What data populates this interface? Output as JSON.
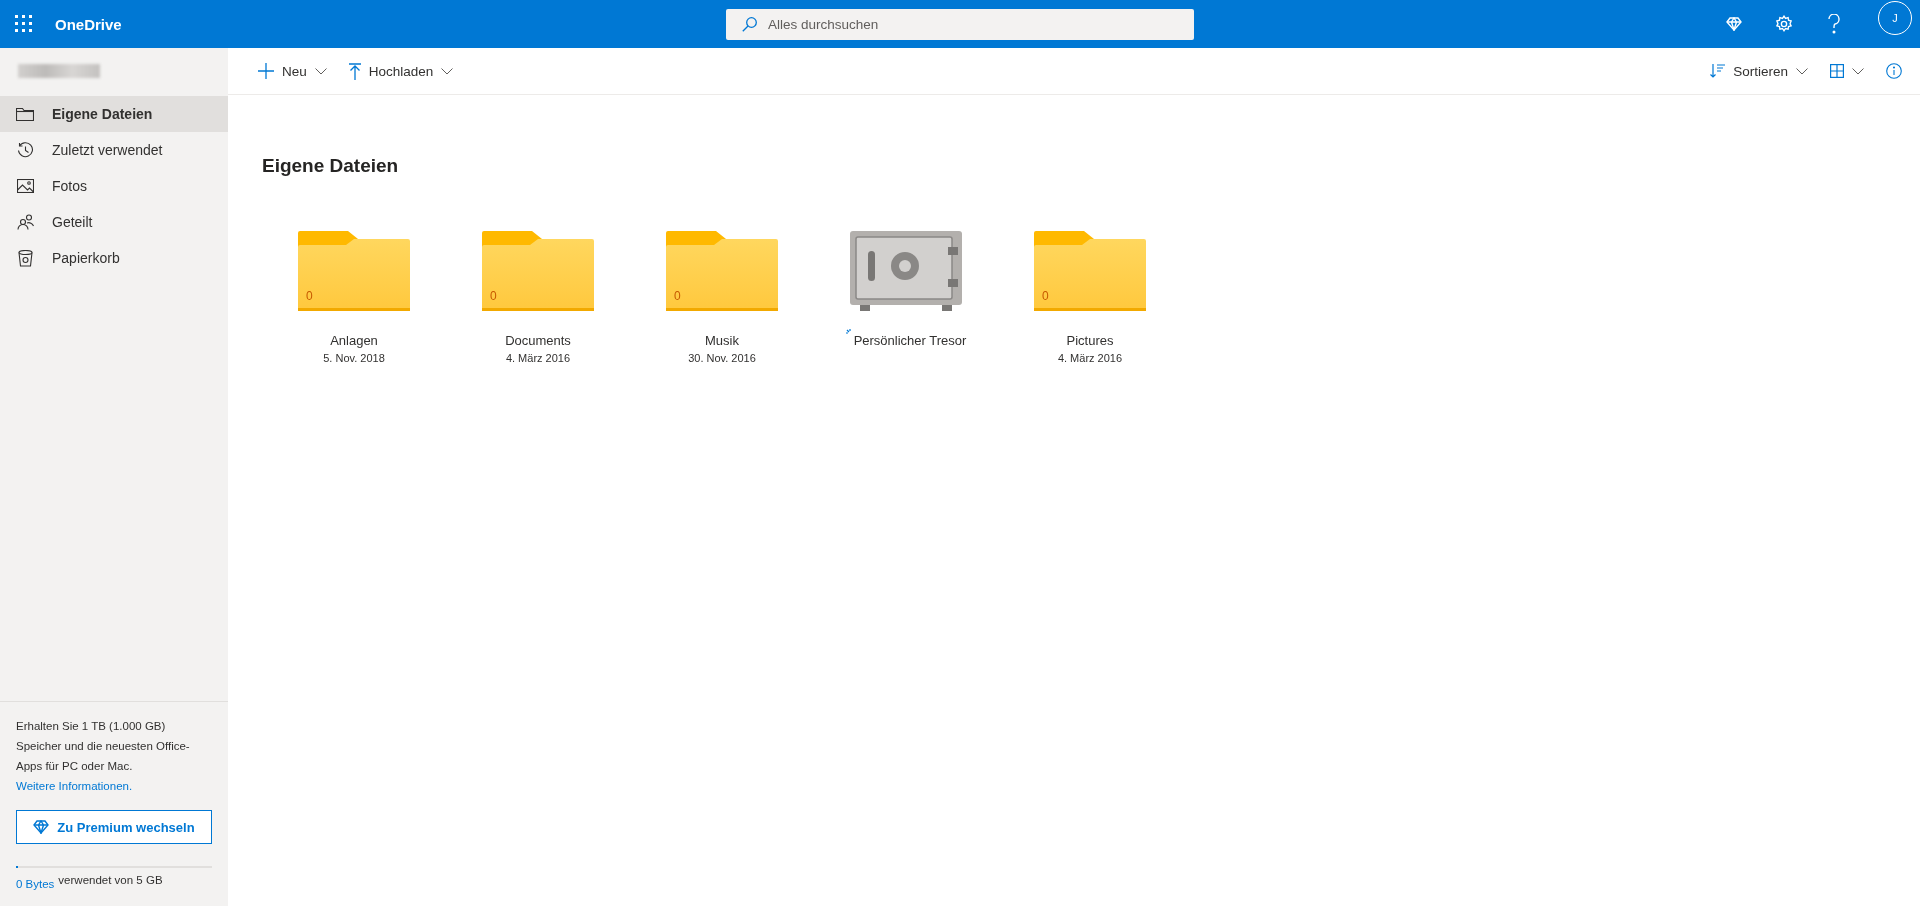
{
  "header": {
    "app_name": "OneDrive",
    "search": {
      "placeholder": "Alles durchsuchen"
    },
    "avatar": "J"
  },
  "sidebar": {
    "items": [
      {
        "label": "Eigene Dateien",
        "selected": true
      },
      {
        "label": "Zuletzt verwendet",
        "selected": false
      },
      {
        "label": "Fotos",
        "selected": false
      },
      {
        "label": "Geteilt",
        "selected": false
      },
      {
        "label": "Papierkorb",
        "selected": false
      }
    ],
    "promo": {
      "text": "Erhalten Sie 1 TB (1.000 GB) Speicher und die neuesten Office-Apps für PC oder Mac.",
      "link": "Weitere Informationen.",
      "button": "Zu Premium wechseln"
    },
    "storage": {
      "level": 0.01,
      "used": "0 Bytes",
      "text": "verwendet von 5 GB"
    }
  },
  "toolbar": {
    "left": [
      {
        "label": "Neu"
      },
      {
        "label": "Hochladen"
      }
    ],
    "sort": "Sortieren"
  },
  "heading": "Eigene Dateien",
  "items": [
    {
      "kind": "folder",
      "name": "Anlagen",
      "date": "5. Nov. 2018",
      "count": "0"
    },
    {
      "kind": "folder",
      "name": "Documents",
      "date": "4. März 2016",
      "count": "0"
    },
    {
      "kind": "folder",
      "name": "Musik",
      "date": "30. Nov. 2016",
      "count": "0"
    },
    {
      "kind": "vault",
      "name": "Persönlicher Tresor",
      "loading": true
    },
    {
      "kind": "folder",
      "name": "Pictures",
      "date": "4. März 2016",
      "count": "0"
    }
  ]
}
